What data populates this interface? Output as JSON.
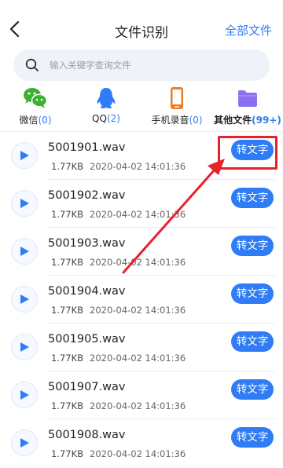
{
  "header": {
    "title": "文件识别",
    "all_files": "全部文件"
  },
  "search": {
    "placeholder": "输入关键字查询文件"
  },
  "tabs": [
    {
      "label": "微信",
      "count": "(0)",
      "icon": "wechat-icon",
      "color": "#3cb034"
    },
    {
      "label": "QQ",
      "count": "(2)",
      "icon": "qq-icon",
      "color": "#2f7cf6"
    },
    {
      "label": "手机录音",
      "count": "(0)",
      "icon": "phone-recorder-icon",
      "color": "#f07b25"
    },
    {
      "label": "其他文件",
      "count": "(99+)",
      "icon": "folder-icon",
      "color": "#8c6ef5"
    }
  ],
  "files": [
    {
      "name": "5001901.wav",
      "size": "1.77KB",
      "time": "2020-04-02 14:01:36",
      "action": "转文字"
    },
    {
      "name": "5001902.wav",
      "size": "1.77KB",
      "time": "2020-04-02 14:01:36",
      "action": "转文字"
    },
    {
      "name": "5001903.wav",
      "size": "1.77KB",
      "time": "2020-04-02 14:01:36",
      "action": "转文字"
    },
    {
      "name": "5001904.wav",
      "size": "1.77KB",
      "time": "2020-04-02 14:01:36",
      "action": "转文字"
    },
    {
      "name": "5001905.wav",
      "size": "1.77KB",
      "time": "2020-04-02 14:01:36",
      "action": "转文字"
    },
    {
      "name": "5001907.wav",
      "size": "1.77KB",
      "time": "2020-04-02 14:01:36",
      "action": "转文字"
    },
    {
      "name": "5001908.wav",
      "size": "1.77KB",
      "time": "2020-04-02 14:01:36",
      "action": "转文字"
    }
  ],
  "colors": {
    "accent": "#2f7cf6",
    "annotation": "#e8212b"
  }
}
